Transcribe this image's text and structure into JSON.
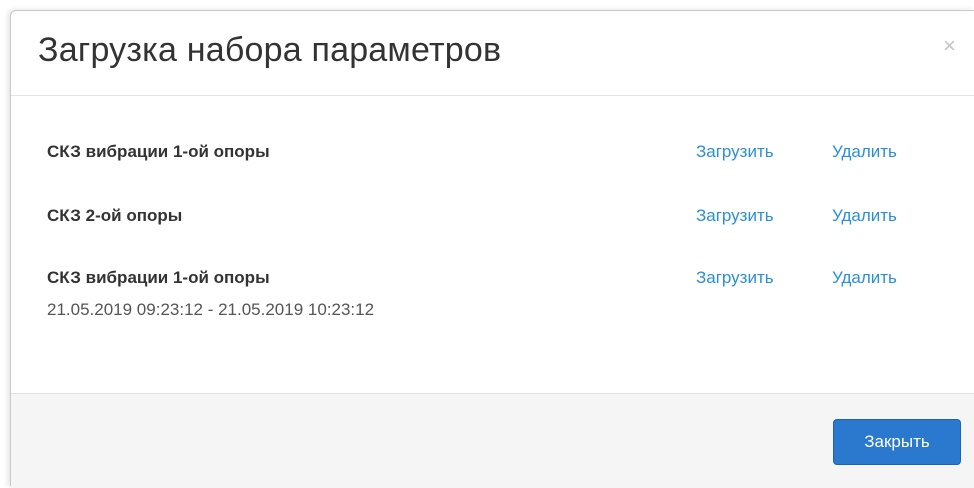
{
  "dialog": {
    "title": "Загрузка набора параметров",
    "close_icon_glyph": "×"
  },
  "presets": [
    {
      "name": "СКЗ вибрации 1-ой опоры",
      "range": "",
      "load_label": "Загрузить",
      "delete_label": "Удалить"
    },
    {
      "name": "СКЗ 2-ой опоры",
      "range": "",
      "load_label": "Загрузить",
      "delete_label": "Удалить"
    },
    {
      "name": "СКЗ вибрации 1-ой опоры",
      "range": "21.05.2019 09:23:12 - 21.05.2019 10:23:12",
      "load_label": "Загрузить",
      "delete_label": "Удалить"
    }
  ],
  "footer": {
    "close_label": "Закрыть"
  },
  "colors": {
    "link": "#2a8fd4",
    "primary_button": "#2b79ce",
    "footer_bg": "#f5f5f5"
  }
}
